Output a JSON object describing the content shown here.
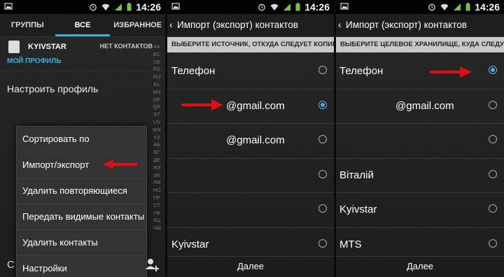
{
  "status": {
    "time": "14:26"
  },
  "panel1": {
    "tabs": [
      {
        "label": "ГРУППЫ"
      },
      {
        "label": "ВСЕ"
      },
      {
        "label": "ИЗБРАННОЕ"
      }
    ],
    "profile": {
      "name": "KYIVSTAR",
      "no_contacts": "НЕТ КОНТАКТОВ",
      "label": "МОЙ ПРОФИЛЬ"
    },
    "setup_profile": "Настроить профиль",
    "index_letters": "#ABCDEFGHIJKLMNOPQRSTUVWXYZАБВГДЕЖЗИКЛМНОПРСТУФХЦЧШ",
    "menu": [
      {
        "label": "Сортировать по"
      },
      {
        "label": "Импорт/экспорт"
      },
      {
        "label": "Удалить повторяющиеся"
      },
      {
        "label": "Передать видимые контакты"
      },
      {
        "label": "Удалить контакты"
      },
      {
        "label": "Настройки"
      }
    ],
    "bottom_letter": "С"
  },
  "panel2": {
    "title": "Импорт (экспорт) контактов",
    "subheader": "ВЫБЕРИТЕ ИСТОЧНИК, ОТКУДА СЛЕДУЕТ КОПИРОВАТЬ КОНТАКТЫ",
    "rows": [
      {
        "label": "Телефон",
        "selected": false
      },
      {
        "label": "@gmail.com",
        "selected": true
      },
      {
        "label": "@gmail.com",
        "selected": false
      },
      {
        "label": "",
        "selected": false
      },
      {
        "label": "",
        "selected": false
      },
      {
        "label": "Kyivstar",
        "selected": false
      }
    ],
    "next": "Далее"
  },
  "panel3": {
    "title": "Импорт (экспорт) контактов",
    "subheader": "ВЫБЕРИТЕ ЦЕЛЕВОЕ ХРАНИЛИЩЕ, КУДА СЛЕДУЕТ КОПИРОВАТЬ КОНТАКТЫ",
    "rows": [
      {
        "label": "Телефон",
        "selected": true
      },
      {
        "label": "@gmail.com",
        "selected": false
      },
      {
        "label": "",
        "selected": false
      },
      {
        "label": "Віталій",
        "selected": false
      },
      {
        "label": "Kyivstar",
        "selected": false
      },
      {
        "label": "MTS",
        "selected": false
      }
    ],
    "next": "Далее"
  },
  "colors": {
    "accent": "#33b5e5",
    "annotation": "#e01010"
  }
}
